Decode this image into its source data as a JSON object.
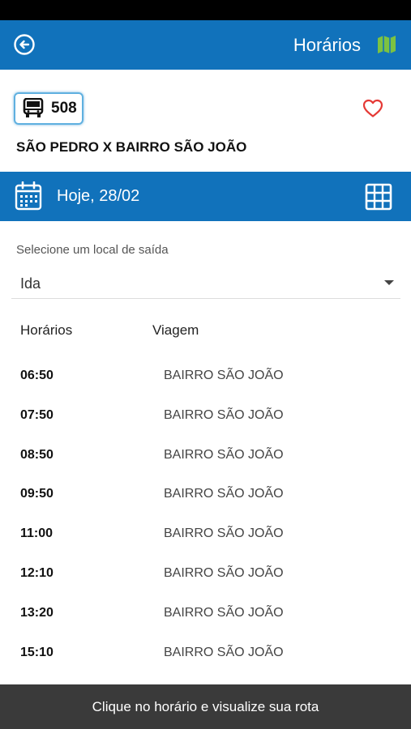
{
  "header": {
    "title": "Horários"
  },
  "route": {
    "number": "508",
    "name": "SÃO PEDRO X BAIRRO SÃO JOÃO"
  },
  "date": {
    "label": "Hoje, 28/02"
  },
  "departure": {
    "label": "Selecione um local de saída",
    "selected": "Ida"
  },
  "table": {
    "headers": {
      "time": "Horários",
      "trip": "Viagem"
    },
    "rows": [
      {
        "time": "06:50",
        "trip": "BAIRRO SÃO JOÃO"
      },
      {
        "time": "07:50",
        "trip": "BAIRRO SÃO JOÃO"
      },
      {
        "time": "08:50",
        "trip": "BAIRRO SÃO JOÃO"
      },
      {
        "time": "09:50",
        "trip": "BAIRRO SÃO JOÃO"
      },
      {
        "time": "11:00",
        "trip": "BAIRRO SÃO JOÃO"
      },
      {
        "time": "12:10",
        "trip": "BAIRRO SÃO JOÃO"
      },
      {
        "time": "13:20",
        "trip": "BAIRRO SÃO JOÃO"
      },
      {
        "time": "15:10",
        "trip": "BAIRRO SÃO JOÃO"
      }
    ]
  },
  "footer": {
    "hint": "Clique no horário e visualize sua rota"
  },
  "colors": {
    "primary": "#1172bb",
    "map_icon": "#7cc242",
    "favorite": "#e53935",
    "footer_bg": "#3a3a3a"
  },
  "icons": {
    "back": "back-arrow-circle-icon",
    "map": "map-icon",
    "bus": "bus-icon",
    "favorite": "heart-outline-icon",
    "calendar": "calendar-icon",
    "grid": "grid-icon"
  }
}
